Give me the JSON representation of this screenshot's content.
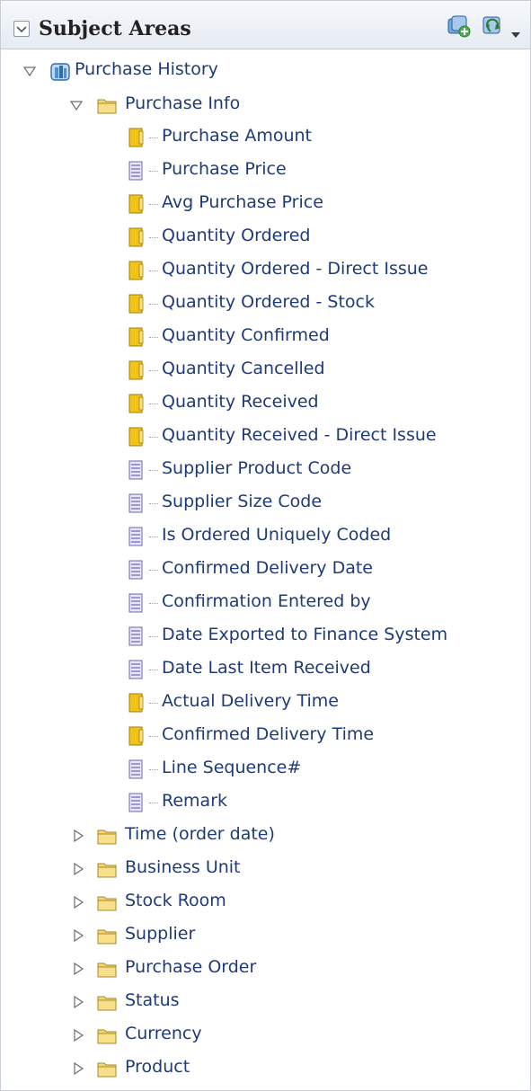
{
  "panel": {
    "title": "Subject Areas",
    "header_icons": [
      "add-subject-area-icon",
      "refresh-icon",
      "dropdown-arrow-icon"
    ]
  },
  "subject_area": {
    "label": "Purchase History",
    "icon": "subject-area-cube-icon",
    "expanded": true
  },
  "purchase_info": {
    "label": "Purchase Info",
    "icon": "folder-icon",
    "expanded": true,
    "columns": [
      {
        "label": "Purchase Amount",
        "kind": "measure"
      },
      {
        "label": "Purchase Price",
        "kind": "attribute"
      },
      {
        "label": "Avg Purchase Price",
        "kind": "measure"
      },
      {
        "label": "Quantity Ordered",
        "kind": "measure"
      },
      {
        "label": "Quantity Ordered - Direct Issue",
        "kind": "measure"
      },
      {
        "label": "Quantity Ordered - Stock",
        "kind": "measure"
      },
      {
        "label": "Quantity Confirmed",
        "kind": "measure"
      },
      {
        "label": "Quantity Cancelled",
        "kind": "measure"
      },
      {
        "label": "Quantity Received",
        "kind": "measure"
      },
      {
        "label": "Quantity Received - Direct Issue",
        "kind": "measure"
      },
      {
        "label": "Supplier Product Code",
        "kind": "attribute"
      },
      {
        "label": "Supplier Size Code",
        "kind": "attribute"
      },
      {
        "label": "Is Ordered Uniquely Coded",
        "kind": "attribute"
      },
      {
        "label": "Confirmed Delivery Date",
        "kind": "attribute"
      },
      {
        "label": "Confirmation Entered by",
        "kind": "attribute"
      },
      {
        "label": "Date Exported to Finance System",
        "kind": "attribute"
      },
      {
        "label": "Date Last Item Received",
        "kind": "attribute"
      },
      {
        "label": "Actual Delivery Time",
        "kind": "measure"
      },
      {
        "label": "Confirmed Delivery Time",
        "kind": "measure"
      },
      {
        "label": "Line Sequence#",
        "kind": "attribute"
      },
      {
        "label": "Remark",
        "kind": "attribute"
      }
    ]
  },
  "folders": [
    {
      "label": "Time (order date)",
      "expanded": false
    },
    {
      "label": "Business Unit",
      "expanded": false
    },
    {
      "label": "Stock Room",
      "expanded": false
    },
    {
      "label": "Supplier",
      "expanded": false
    },
    {
      "label": "Purchase Order",
      "expanded": false
    },
    {
      "label": "Status",
      "expanded": false
    },
    {
      "label": "Currency",
      "expanded": false
    },
    {
      "label": "Product",
      "expanded": false
    }
  ],
  "colors": {
    "label": "#1f3a78",
    "measure_icon": "#f0c419",
    "attribute_icon": "#8a83c9",
    "folder": "#f5d76e"
  }
}
